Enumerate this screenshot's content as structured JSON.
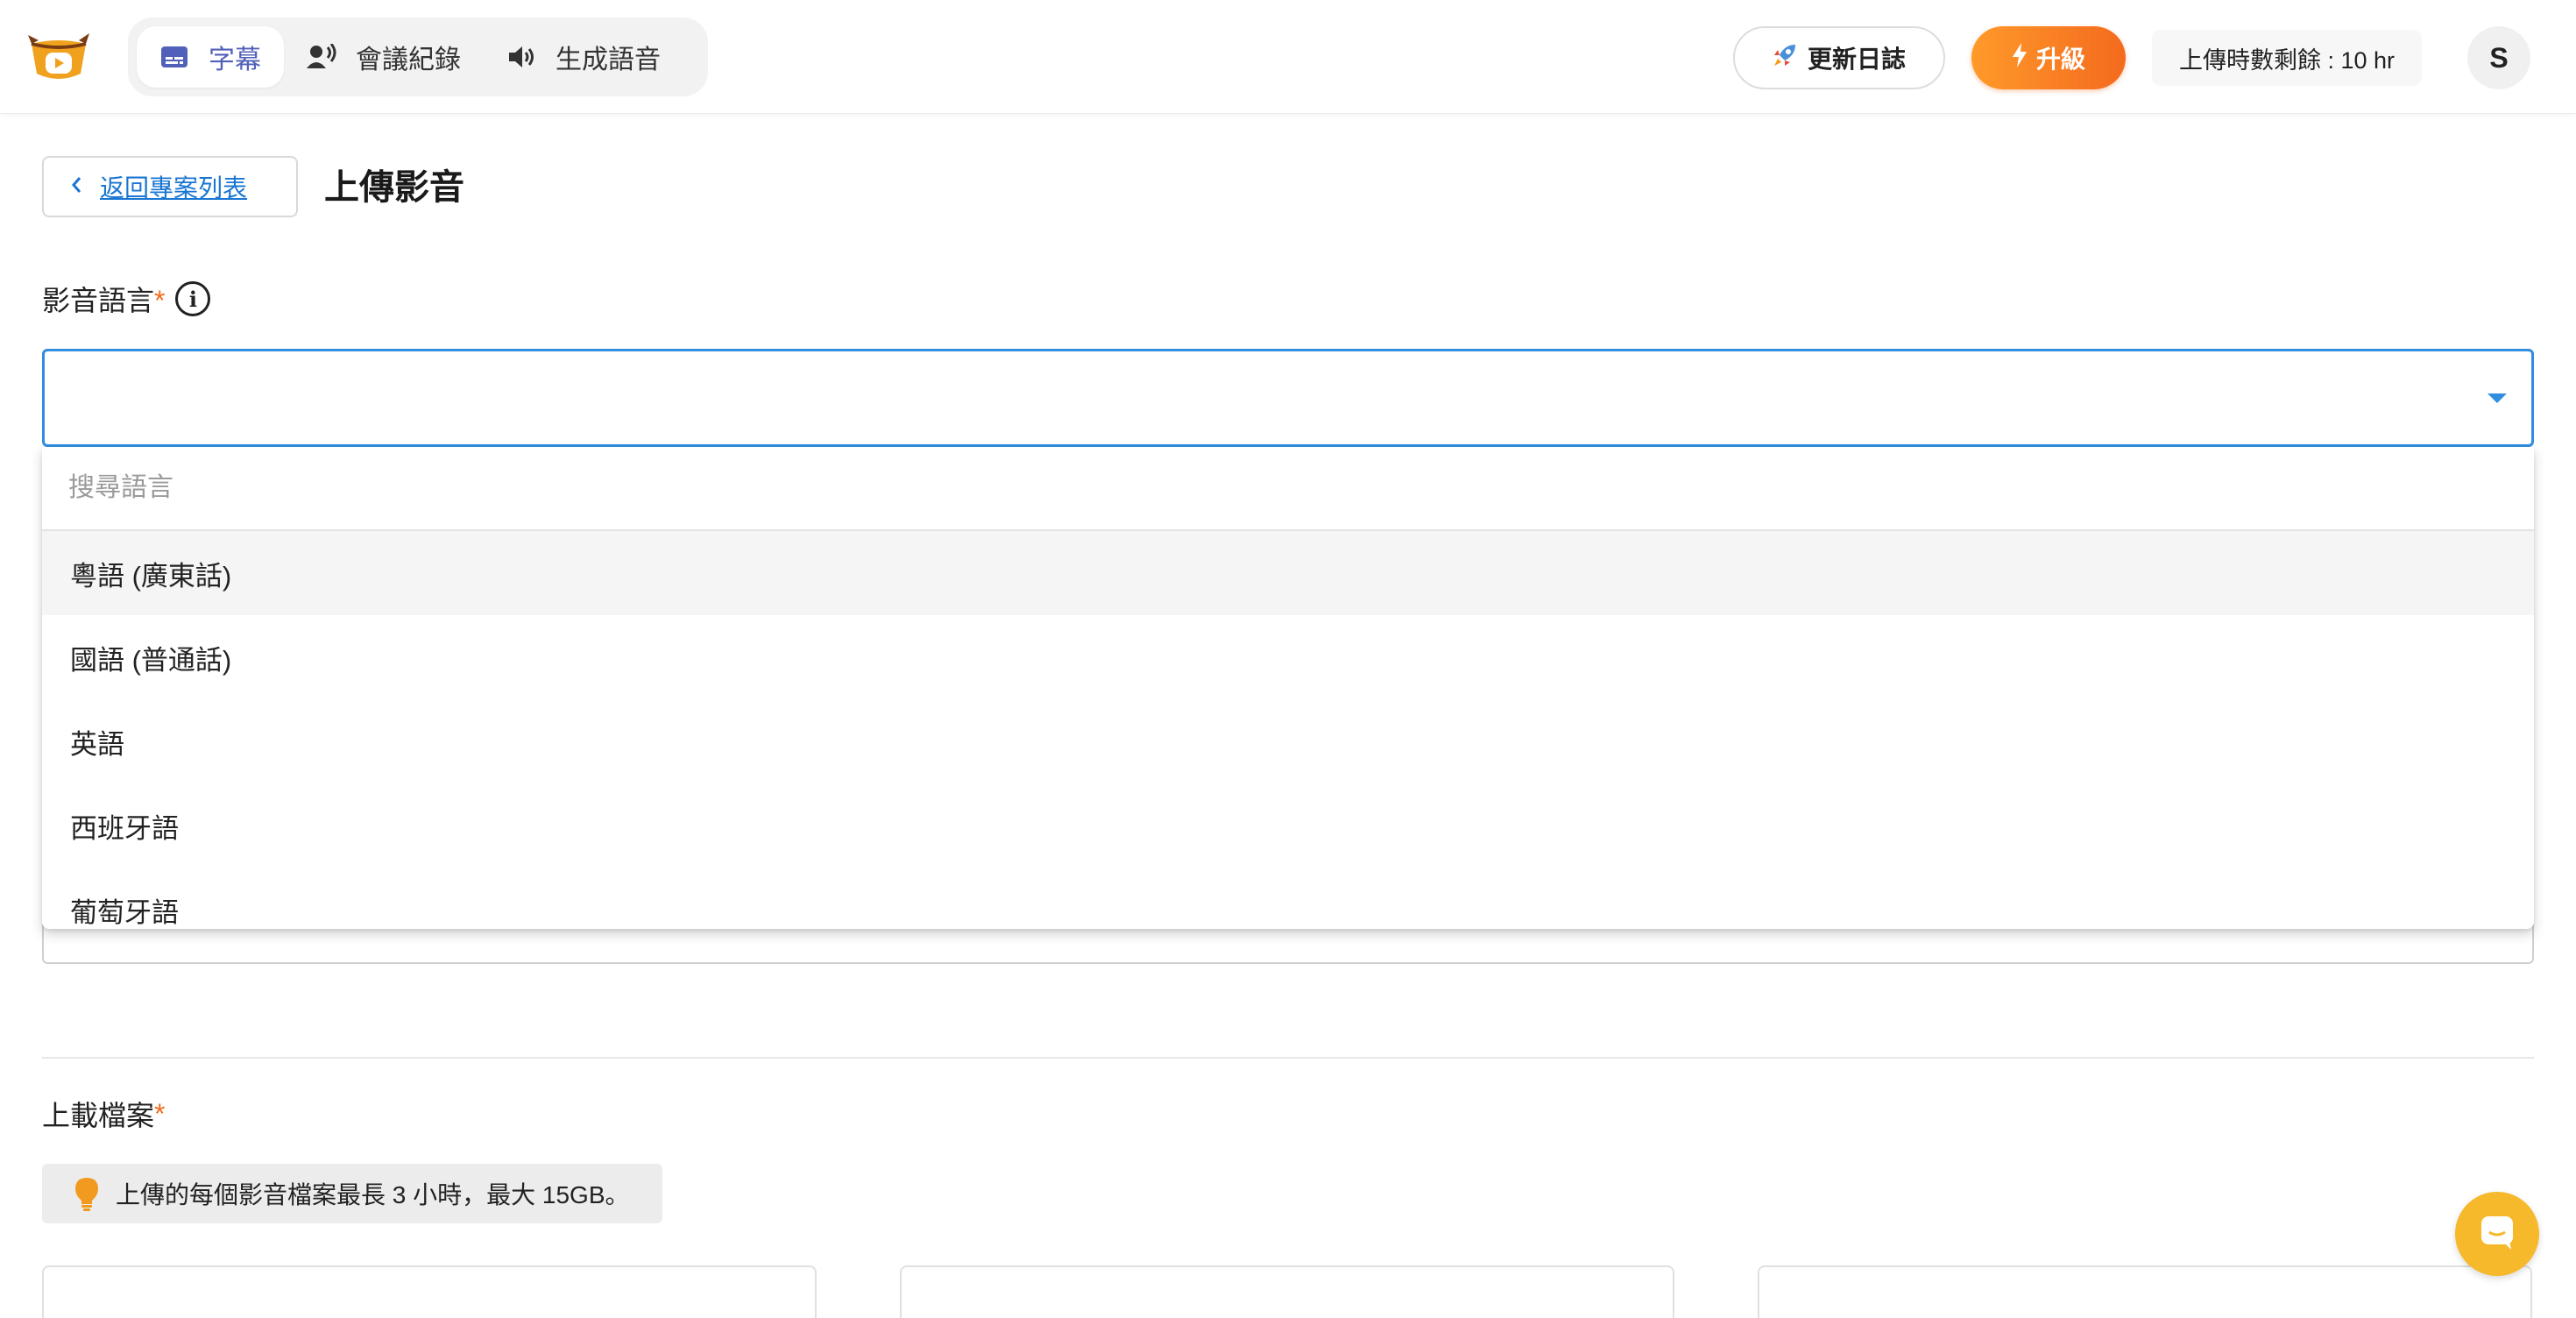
{
  "header": {
    "logo_icon": "app-logo-bowl-icon",
    "nav": [
      {
        "label": "字幕",
        "icon": "subtitles-icon",
        "active": true
      },
      {
        "label": "會議紀錄",
        "icon": "voice-person-icon",
        "active": false
      },
      {
        "label": "生成語音",
        "icon": "speaker-icon",
        "active": false
      }
    ],
    "changelog_label": "更新日誌",
    "changelog_icon": "rocket-icon",
    "upgrade_label": "升級",
    "upgrade_icon": "bolt-icon",
    "quota_text": "上傳時數剩餘 : 10 hr",
    "avatar_initial": "S"
  },
  "page": {
    "back_label": "返回專案列表",
    "title": "上傳影音"
  },
  "language_field": {
    "label": "影音語言",
    "required_mark": "*",
    "info_icon": "info-icon",
    "value": "",
    "search_placeholder": "搜尋語言",
    "options": [
      "粵語 (廣東話)",
      "國語 (普通話)",
      "英語",
      "西班牙語",
      "葡萄牙語"
    ],
    "hovered_index": 0
  },
  "upload_section": {
    "label": "上載檔案",
    "required_mark": "*",
    "tip_text": "上傳的每個影音檔案最長 3 小時，最大 15GB。",
    "tip_icon": "lightbulb-icon"
  },
  "colors": {
    "accent": "#5160b8",
    "focus_blue": "#2f8ee0",
    "link_blue": "#1976d2",
    "upgrade_orange": "#f46a1e",
    "required_orange": "#f26b1d",
    "chat_yellow": "#f6b92b"
  }
}
